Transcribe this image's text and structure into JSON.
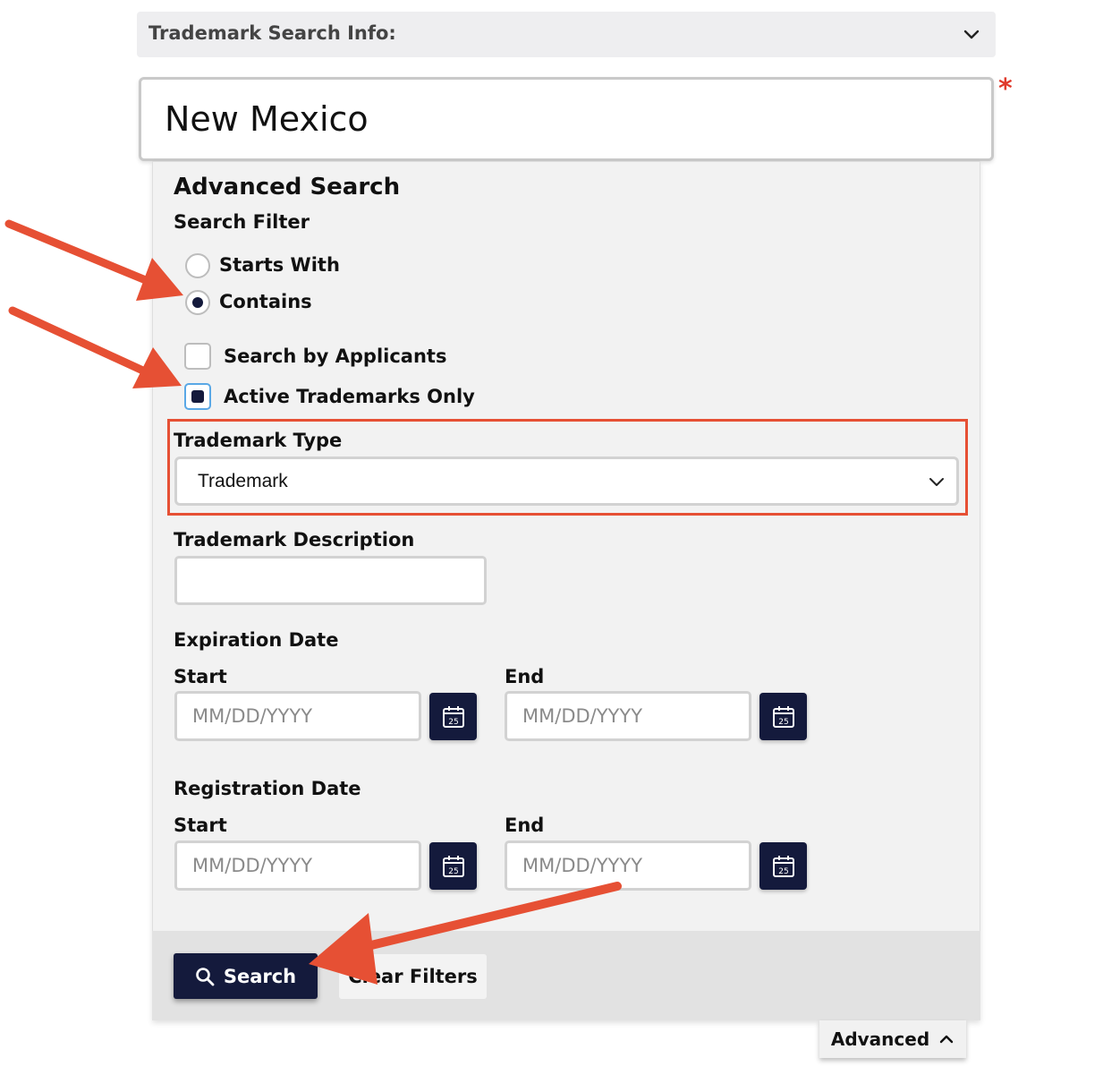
{
  "header": {
    "title": "Trademark Search Info:"
  },
  "search": {
    "value": "New Mexico",
    "required_marker": "*"
  },
  "advanced": {
    "heading": "Advanced Search",
    "search_filter_label": "Search Filter",
    "filter_options": [
      {
        "label": "Starts With",
        "selected": false
      },
      {
        "label": "Contains",
        "selected": true
      }
    ],
    "checkboxes": [
      {
        "label": "Search by Applicants",
        "checked": false
      },
      {
        "label": "Active Trademarks Only",
        "checked": true
      }
    ],
    "trademark_type": {
      "label": "Trademark Type",
      "selected": "Trademark"
    },
    "trademark_description": {
      "label": "Trademark Description",
      "value": ""
    },
    "expiration_date": {
      "label": "Expiration Date",
      "start_label": "Start",
      "end_label": "End",
      "start_placeholder": "MM/DD/YYYY",
      "end_placeholder": "MM/DD/YYYY"
    },
    "registration_date": {
      "label": "Registration Date",
      "start_label": "Start",
      "end_label": "End",
      "start_placeholder": "MM/DD/YYYY",
      "end_placeholder": "MM/DD/YYYY"
    },
    "calendar_day": "25"
  },
  "footer": {
    "search_label": "Search",
    "clear_label": "Clear Filters",
    "advanced_toggle_label": "Advanced"
  },
  "colors": {
    "primary": "#141a3c",
    "annotation": "#e65034",
    "required": "#e03a2c"
  },
  "icons": {
    "header_chevron": "chevron-down-icon",
    "select_chevron": "chevron-down-icon",
    "calendar": "calendar-icon",
    "search": "search-icon",
    "advanced_chevron": "chevron-up-icon"
  }
}
